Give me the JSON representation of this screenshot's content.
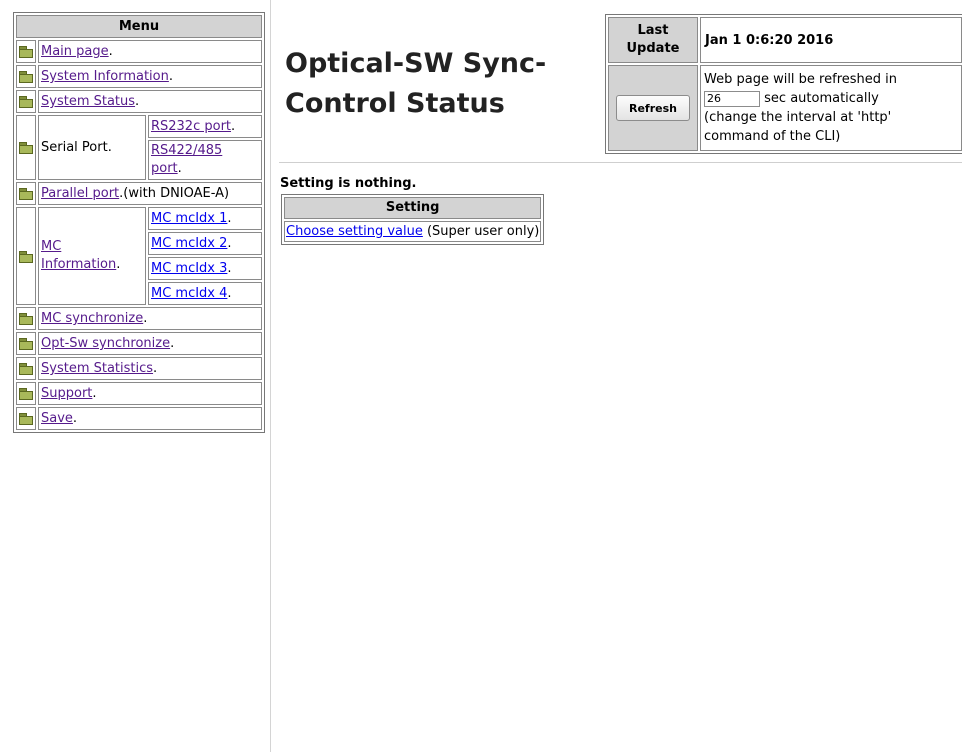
{
  "menu": {
    "header": "Menu",
    "main_page": "Main page",
    "system_information": "System Information",
    "system_status": "System Status",
    "serial_port_label": "Serial Port.",
    "rs232c": "RS232c port",
    "rs422_line1": "RS422/485",
    "rs422_line2": "port",
    "parallel_port": "Parallel port",
    "parallel_suffix": ".(with DNIOAE-A)",
    "mc_info_line1": "MC",
    "mc_info_line2": "Information",
    "mc_idx": [
      "MC mcIdx 1",
      "MC mcIdx 2",
      "MC mcIdx 3",
      "MC mcIdx 4"
    ],
    "mc_synchronize": "MC synchronize",
    "opt_sw_synchronize": "Opt-Sw synchronize",
    "system_statistics": "System Statistics",
    "support": "Support",
    "save": "Save",
    "dot": "."
  },
  "page": {
    "title_line1": "Optical-SW Sync-",
    "title_line2": "Control Status"
  },
  "update": {
    "label_line1": "Last",
    "label_line2": "Update",
    "value": "Jan 1 0:6:20 2016",
    "refresh_button": "Refresh",
    "refresh_line1": "Web page will be refreshed in",
    "interval_value": "26",
    "refresh_line2": "sec automatically",
    "refresh_line3": "(change the interval at 'http'",
    "refresh_line4": "command of the CLI)"
  },
  "setting": {
    "status_text": "Setting is nothing.",
    "header": "Setting",
    "link": "Choose setting value",
    "note": "(Super user only)"
  }
}
